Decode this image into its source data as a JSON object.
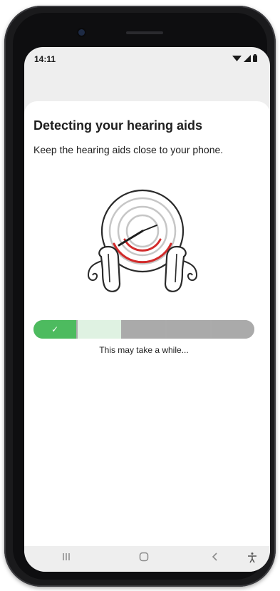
{
  "status_bar": {
    "time": "14:11",
    "icons": [
      "wifi-icon",
      "signal-icon",
      "battery-icon"
    ]
  },
  "screen": {
    "title": "Detecting your hearing aids",
    "subtitle": "Keep the hearing aids close to your phone.",
    "illustration_icon": "hearing-aids-scanning-icon",
    "progress": {
      "segments": 5,
      "completed": 1,
      "active": 2,
      "check_icon": "checkmark-icon"
    },
    "note": "This may take a while..."
  },
  "nav_bar": {
    "recents_icon": "recents-icon",
    "home_icon": "home-icon",
    "back_icon": "back-icon",
    "accessibility_icon": "accessibility-icon"
  },
  "colors": {
    "accent_green": "#4dbb5f",
    "active_segment": "#dff2e2",
    "pending_segment": "#aaaaaa",
    "arc_red": "#d22b2b"
  }
}
